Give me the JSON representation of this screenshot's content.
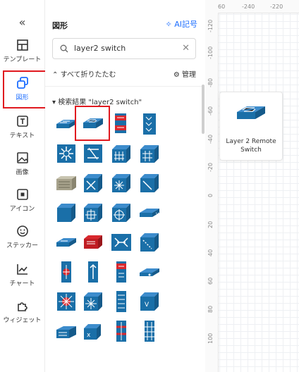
{
  "rail": {
    "collapse_glyph": "«",
    "items": [
      {
        "label": "テンプレート",
        "icon": "template-icon"
      },
      {
        "label": "図形",
        "icon": "shapes-icon",
        "active": true
      },
      {
        "label": "テキスト",
        "icon": "text-icon"
      },
      {
        "label": "画像",
        "icon": "image-icon"
      },
      {
        "label": "アイコン",
        "icon": "icon-icon"
      },
      {
        "label": "ステッカー",
        "icon": "sticker-icon"
      },
      {
        "label": "チャート",
        "icon": "chart-icon"
      },
      {
        "label": "ウィジェット",
        "icon": "widget-icon"
      }
    ]
  },
  "panel": {
    "title": "図形",
    "ai_label": "AI記号",
    "search": {
      "value": "layer2 switch",
      "placeholder": ""
    },
    "collapse_all": "すべて折りたたむ",
    "manage": "管理",
    "results_header": "検索結果 \"layer2 switch\""
  },
  "canvas": {
    "h_ruler": [
      "60",
      "-240",
      "-220"
    ],
    "v_ruler": [
      "-120",
      "-100",
      "-80",
      "-60",
      "-40",
      "-20",
      "0",
      "20",
      "40",
      "60",
      "80",
      "100"
    ],
    "node_label_line1": "Layer 2 Remote",
    "node_label_line2": "Switch"
  },
  "colors": {
    "accent": "#1f6fff",
    "highlight": "#e0191f",
    "cisco_blue": "#1a6fa8"
  }
}
